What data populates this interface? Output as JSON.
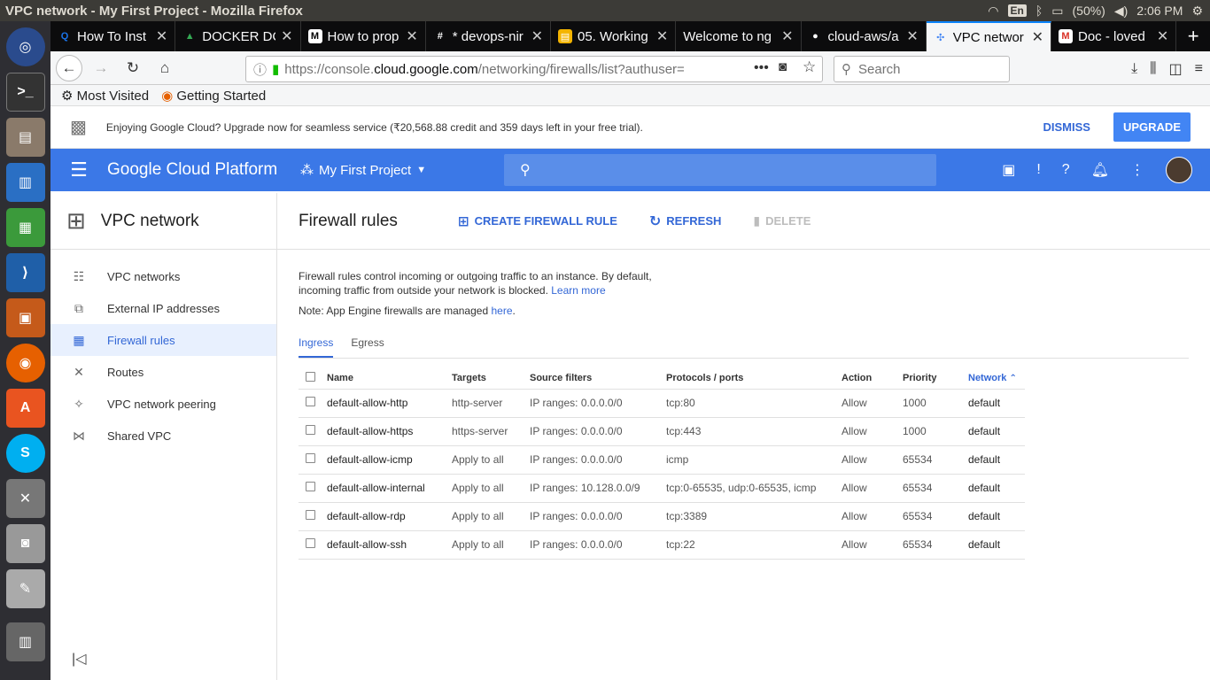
{
  "os": {
    "window_title": "VPC network - My First Project - Mozilla Firefox",
    "lang": "En",
    "battery": "(50%)",
    "clock": "2:06 PM"
  },
  "launcher": {
    "icons": [
      "ubuntu-icon",
      "terminal-icon",
      "files-icon",
      "writer-icon",
      "calc-icon",
      "vscode-icon",
      "impress-icon",
      "firefox-icon",
      "software-center-icon",
      "skype-icon",
      "settings-icon",
      "camera-icon",
      "text-editor-icon",
      "trash-icon"
    ]
  },
  "tabs": [
    {
      "label": "How To Inst",
      "favicon": "Q",
      "color": "#1a73e8"
    },
    {
      "label": "DOCKER DC",
      "favicon": "▲",
      "color": "#34a853"
    },
    {
      "label": "How to prop",
      "favicon": "M",
      "color": "#000000"
    },
    {
      "label": "* devops-nir",
      "favicon": "#",
      "color": "#611f69"
    },
    {
      "label": "05. Working",
      "favicon": "▤",
      "color": "#f4b400"
    },
    {
      "label": "Welcome to ng",
      "favicon": "",
      "color": "#0c0c0d"
    },
    {
      "label": "cloud-aws/a",
      "favicon": "●",
      "color": "#ffffff"
    },
    {
      "label": "VPC networ",
      "favicon": "✣",
      "color": "#4285f4",
      "active": true
    },
    {
      "label": "Doc - loved",
      "favicon": "M",
      "color": "#d93025"
    }
  ],
  "nav": {
    "url_prefix": "https://console.",
    "url_domain": "cloud.google.com",
    "url_path": "/networking/firewalls/list?authuser=",
    "search_placeholder": "Search"
  },
  "bookmarks": {
    "most_visited": "Most Visited",
    "getting_started": "Getting Started"
  },
  "banner": {
    "text": "Enjoying Google Cloud? Upgrade now for seamless service (₹20,568.88 credit and 359 days left in your free trial).",
    "dismiss": "DISMISS",
    "upgrade": "UPGRADE"
  },
  "gcp": {
    "brand": "Google Cloud Platform",
    "project": "My First Project"
  },
  "sidenav": {
    "title": "VPC network",
    "items": [
      {
        "label": "VPC networks",
        "icon": "networks-icon",
        "glyph": "☷"
      },
      {
        "label": "External IP addresses",
        "icon": "external-ip-icon",
        "glyph": "⧉"
      },
      {
        "label": "Firewall rules",
        "icon": "firewall-icon",
        "glyph": "▦",
        "active": true
      },
      {
        "label": "Routes",
        "icon": "routes-icon",
        "glyph": "✕"
      },
      {
        "label": "VPC network peering",
        "icon": "peering-icon",
        "glyph": "✧"
      },
      {
        "label": "Shared VPC",
        "icon": "shared-vpc-icon",
        "glyph": "⋈"
      }
    ]
  },
  "page": {
    "title": "Firewall rules",
    "create": "CREATE FIREWALL RULE",
    "refresh": "REFRESH",
    "delete": "DELETE",
    "desc": "Firewall rules control incoming or outgoing traffic to an instance. By default, incoming traffic from outside your network is blocked.",
    "learn_more": "Learn more",
    "note": "Note: App Engine firewalls are managed",
    "here": "here",
    "tab_ingress": "Ingress",
    "tab_egress": "Egress"
  },
  "table": {
    "headers": [
      "Name",
      "Targets",
      "Source filters",
      "Protocols / ports",
      "Action",
      "Priority",
      "Network"
    ],
    "rows": [
      [
        "default-allow-http",
        "http-server",
        "IP ranges: 0.0.0.0/0",
        "tcp:80",
        "Allow",
        "1000",
        "default"
      ],
      [
        "default-allow-https",
        "https-server",
        "IP ranges: 0.0.0.0/0",
        "tcp:443",
        "Allow",
        "1000",
        "default"
      ],
      [
        "default-allow-icmp",
        "Apply to all",
        "IP ranges: 0.0.0.0/0",
        "icmp",
        "Allow",
        "65534",
        "default"
      ],
      [
        "default-allow-internal",
        "Apply to all",
        "IP ranges: 10.128.0.0/9",
        "tcp:0-65535, udp:0-65535, icmp",
        "Allow",
        "65534",
        "default"
      ],
      [
        "default-allow-rdp",
        "Apply to all",
        "IP ranges: 0.0.0.0/0",
        "tcp:3389",
        "Allow",
        "65534",
        "default"
      ],
      [
        "default-allow-ssh",
        "Apply to all",
        "IP ranges: 0.0.0.0/0",
        "tcp:22",
        "Allow",
        "65534",
        "default"
      ]
    ]
  }
}
